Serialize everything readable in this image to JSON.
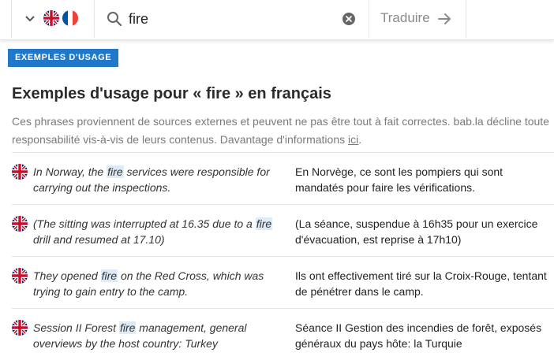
{
  "search": {
    "query": "fire",
    "translate_label": "Traduire"
  },
  "section": {
    "badge": "EXEMPLES D'USAGE",
    "title": "Exemples d'usage pour « fire » en français",
    "disclaimer_text": "Ces phrases proviennent de sources externes et peuvent ne pas être tout à fait correctes. bab.la décline toute responsabilité vis-à-vis de leurs contenus. Davantage d'informations ",
    "disclaimer_link": "ici",
    "disclaimer_end": "."
  },
  "examples": [
    {
      "src_before": "In Norway, the ",
      "src_hl": "fire",
      "src_after": " services were responsible for carrying out the inspections.",
      "target": "En Norvège, ce sont les pompiers qui sont mandatés pour faire les vérifications."
    },
    {
      "src_before": "(The sitting was interrupted at 16.35 due to a ",
      "src_hl": "fire",
      "src_after": " drill and resumed at 17.10)",
      "target": "(La séance, suspendue à 16h35 pour un exercice d'évacuation, est reprise à 17h10)"
    },
    {
      "src_before": "They opened ",
      "src_hl": "fire",
      "src_after": " on the Red Cross, which was trying to gain entry to the camp.",
      "target": "Ils ont effectivement tiré sur la Croix-Rouge, tentant de pénétrer dans le camp."
    },
    {
      "src_before": "Session II Forest ",
      "src_hl": "fire",
      "src_after": " management, general overviews by the host country: Turkey",
      "target": "Séance II Gestion des incendies de forêt, exposés généraux du pays hôte: la Turquie"
    }
  ],
  "colors": {
    "accent": "#1f79c8",
    "highlight": "#dcebf7"
  },
  "icons": {
    "dropdown": "chevron-down-icon",
    "source_flag": "uk-flag-icon",
    "target_flag": "france-flag-icon",
    "search": "search-icon",
    "clear": "clear-icon",
    "translate": "arrow-right-icon"
  }
}
